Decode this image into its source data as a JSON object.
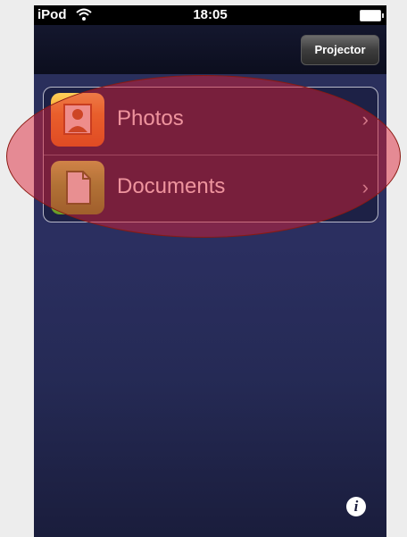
{
  "statusbar": {
    "carrier": "iPod",
    "time": "18:05",
    "wifi_icon": "wifi-icon",
    "battery_icon": "battery-icon"
  },
  "navbar": {
    "projector_label": "Projector"
  },
  "list": {
    "items": [
      {
        "label": "Photos",
        "icon": "photos-icon",
        "chevron": "›"
      },
      {
        "label": "Documents",
        "icon": "documents-icon",
        "chevron": "›"
      }
    ]
  },
  "footer": {
    "info_label": "i",
    "info_icon": "info-icon"
  },
  "colors": {
    "highlight": "#dc1e32",
    "photos_icon": "#f59b27",
    "documents_icon": "#8cbf3a",
    "background": "#2b2f60"
  }
}
